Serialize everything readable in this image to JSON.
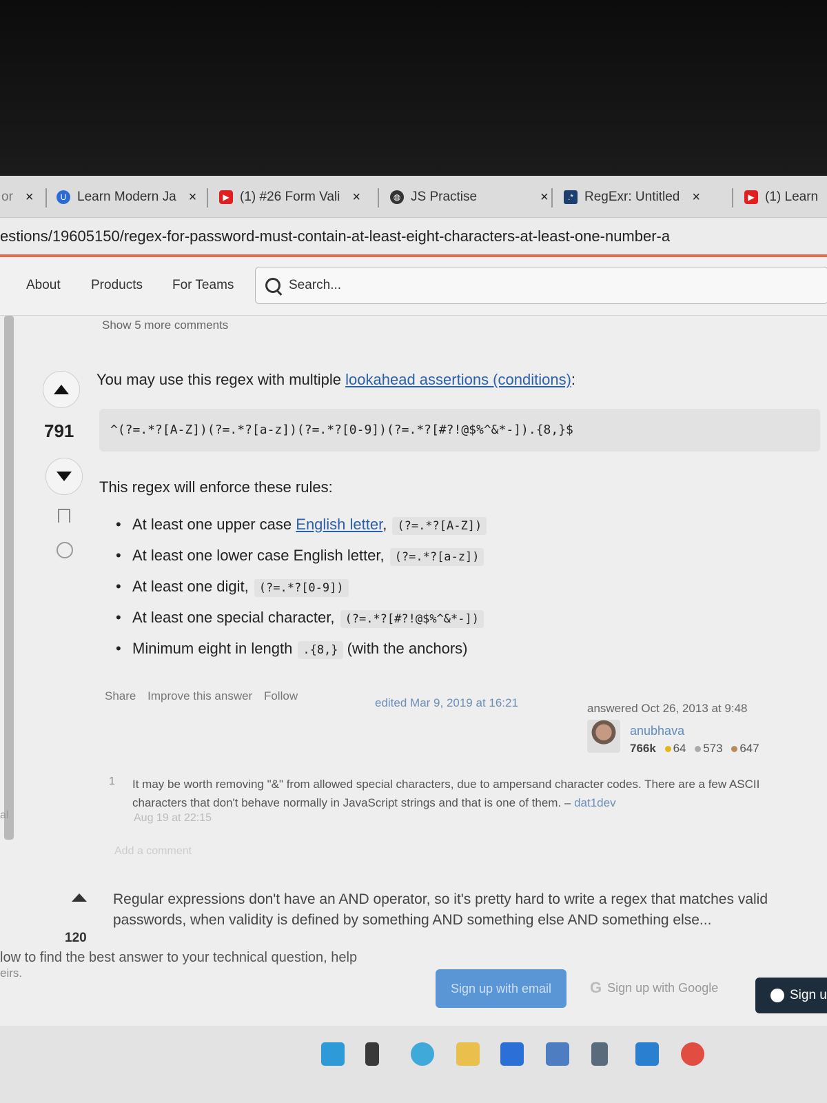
{
  "browser": {
    "tabs": [
      {
        "label": "or",
        "close": "×"
      },
      {
        "label": "Learn Modern Ja",
        "close": "×"
      },
      {
        "label": "(1) #26 Form Vali",
        "close": "×"
      },
      {
        "label": "JS Practise",
        "close": "×"
      },
      {
        "label": "RegExr: Untitled",
        "close": "×"
      },
      {
        "label": "(1) Learn",
        "close": ""
      }
    ],
    "address": "estions/19605150/regex-for-password-must-contain-at-least-eight-characters-at-least-one-number-a"
  },
  "nav": {
    "about": "About",
    "products": "Products",
    "for_teams": "For Teams",
    "search_placeholder": "Search..."
  },
  "answer": {
    "show_more": "Show 5 more comments",
    "score": "791",
    "intro": "You may use this regex with multiple ",
    "intro_link": "lookahead assertions (conditions)",
    "intro_end": ":",
    "regex": "^(?=.*?[A-Z])(?=.*?[a-z])(?=.*?[0-9])(?=.*?[#?!@$%^&*-]).{8,}$",
    "rules_lead": "This regex will enforce these rules:",
    "rules": [
      {
        "text": "At least one upper case ",
        "link": "English letter",
        "sep": ",",
        "code": "(?=.*?[A-Z])",
        "after": ""
      },
      {
        "text": "At least one lower case English letter,",
        "link": "",
        "sep": "",
        "code": "(?=.*?[a-z])",
        "after": ""
      },
      {
        "text": "At least one digit,",
        "link": "",
        "sep": "",
        "code": "(?=.*?[0-9])",
        "after": ""
      },
      {
        "text": "At least one special character,",
        "link": "",
        "sep": "",
        "code": "(?=.*?[#?!@$%^&*-])",
        "after": ""
      },
      {
        "text": "Minimum eight in length",
        "link": "",
        "sep": "",
        "code": ".{8,}",
        "after": " (with the anchors)"
      }
    ],
    "actions": [
      "Share",
      "Improve this answer",
      "Follow"
    ],
    "edited": "edited Mar 9, 2019 at 16:21",
    "answered": "answered Oct 26, 2013 at 9:48",
    "user": {
      "name": "anubhava",
      "reputation": "766k",
      "gold": "64",
      "silver": "573",
      "bronze": "647"
    }
  },
  "comment": {
    "score": "1",
    "text": "It may be worth removing \"&\" from allowed special characters, due to ampersand character codes. There are a few ASCII characters that don't behave normally in JavaScript strings and that is one of them. – ",
    "user": "dat1dev",
    "date": "Aug 19 at 22:15",
    "add": "Add a comment"
  },
  "answer2": {
    "score": "120",
    "text": "Regular expressions don't have an AND operator, so it's pretty hard to write a regex that matches valid passwords, when validity is defined by something AND something else AND something else..."
  },
  "left_edge": "al",
  "signup": {
    "banner": "low to find the best answer to your technical question, help",
    "banner2": "eirs.",
    "email": "Sign up with email",
    "google": "Sign up with Google",
    "github": "Sign u"
  },
  "colors": {
    "link": "#2b5fa8",
    "accent": "#e46a4c",
    "email_button": "#5a95d6",
    "github_button": "#1e2d3b"
  }
}
